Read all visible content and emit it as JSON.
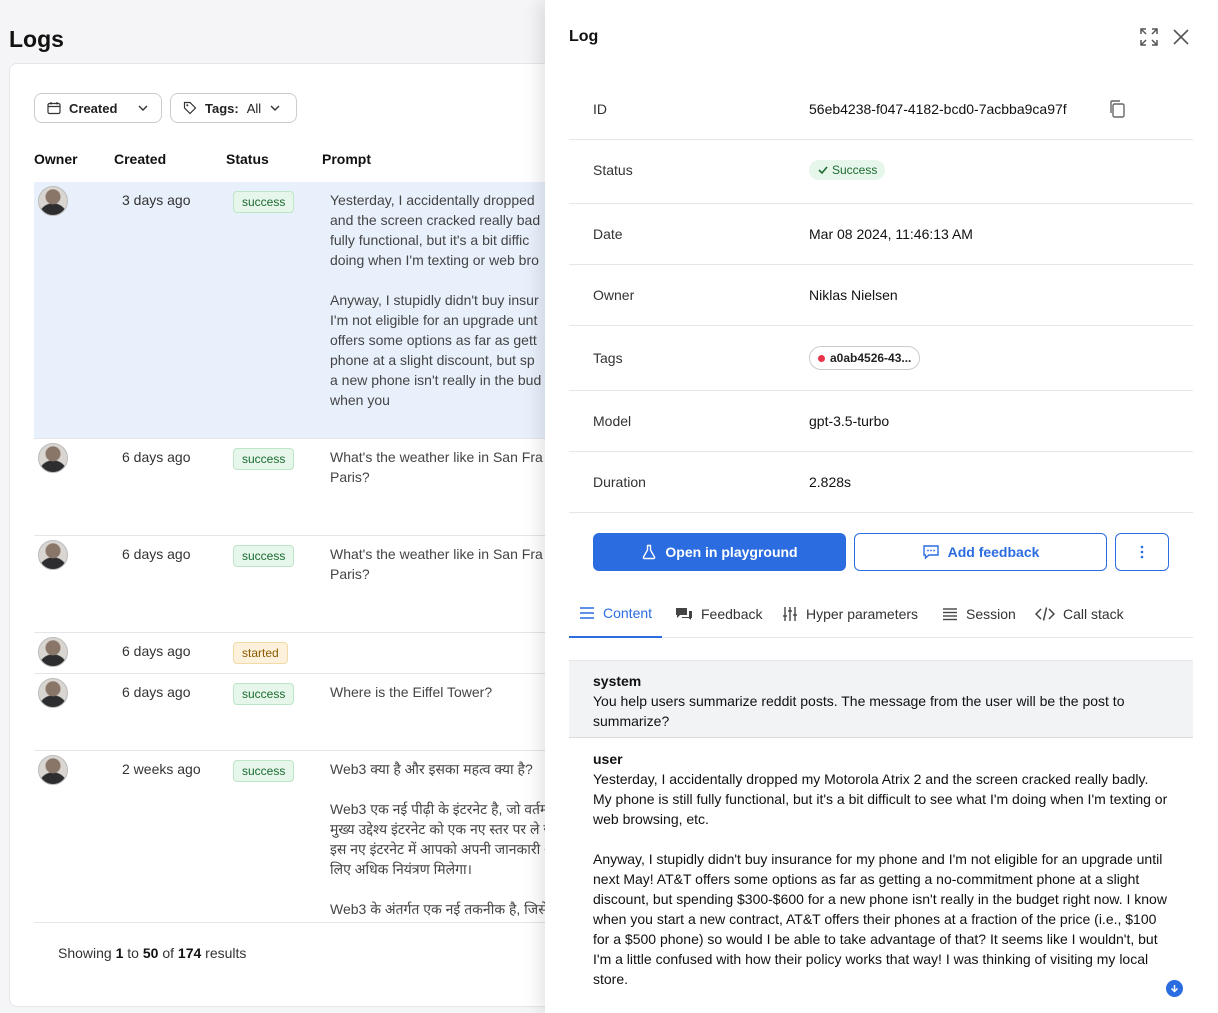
{
  "page": {
    "title": "Logs"
  },
  "filters": {
    "created_label": "Created",
    "tags_label": "Tags:",
    "tags_value": "All"
  },
  "table": {
    "headers": [
      "Owner",
      "Created",
      "Status",
      "Prompt"
    ],
    "rows": [
      {
        "created": "3 days ago",
        "status": "success",
        "prompt": "Yesterday, I accidentally dropped\nand the screen cracked really bad\nfully functional, but it's a bit diffic\ndoing when I'm texting or web bro\n\nAnyway, I stupidly didn't buy insur\nI'm not eligible for an upgrade unt\noffers some options as far as gett\nphone at a slight discount, but sp\na new phone isn't really in the bud\nwhen you"
      },
      {
        "created": "6 days ago",
        "status": "success",
        "prompt": "What's the weather like in San Fra\nParis?"
      },
      {
        "created": "6 days ago",
        "status": "success",
        "prompt": "What's the weather like in San Fra\nParis?"
      },
      {
        "created": "6 days ago",
        "status": "started",
        "prompt": ""
      },
      {
        "created": "6 days ago",
        "status": "success",
        "prompt": "Where is the Eiffel Tower?"
      },
      {
        "created": "2 weeks ago",
        "status": "success",
        "prompt": "Web3 क्या है और इसका महत्व क्या है?\n\nWeb3 एक नई पीढ़ी के इंटरनेट है, जो वर्तम\nमुख्य उद्देश्य इंटरनेट को एक नए स्तर पर ले ज\nइस नए इंटरनेट में आपको अपनी जानकारी अ\nलिए अधिक नियंत्रण मिलेगा।\n\nWeb3 के अंतर्गत एक नई तकनीक है, जिसे"
      }
    ]
  },
  "footer": {
    "showing": "Showing",
    "from": "1",
    "to_word": "to",
    "to": "50",
    "of_word": "of",
    "total": "174",
    "results": "results"
  },
  "panel": {
    "title": "Log",
    "details": {
      "id_label": "ID",
      "id_value": "56eb4238-f047-4182-bcd0-7acbba9ca97f",
      "status_label": "Status",
      "status_value": "Success",
      "date_label": "Date",
      "date_value": "Mar 08 2024, 11:46:13 AM",
      "owner_label": "Owner",
      "owner_value": "Niklas Nielsen",
      "tags_label": "Tags",
      "tag_value": "a0ab4526-43...",
      "model_label": "Model",
      "model_value": "gpt-3.5-turbo",
      "duration_label": "Duration",
      "duration_value": "2.828s"
    },
    "actions": {
      "playground": "Open in playground",
      "feedback": "Add feedback"
    },
    "tabs": {
      "content": "Content",
      "feedback": "Feedback",
      "hyper": "Hyper parameters",
      "session": "Session",
      "callstack": "Call stack"
    },
    "messages": {
      "system_role": "system",
      "system_text": "You help users summarize reddit posts. The message from the user will be the post to summarize?",
      "user_role": "user",
      "user_text": "Yesterday, I accidentally dropped my Motorola Atrix 2 and the screen cracked really badly. My phone is still fully functional, but it's a bit difficult to see what I'm doing when I'm texting or web browsing, etc.\n\nAnyway, I stupidly didn't buy insurance for my phone and I'm not eligible for an upgrade until next May! AT&T offers some options as far as getting a no-commitment phone at a slight discount, but spending $300-$600 for a new phone isn't really in the budget right now. I know when you start a new contract, AT&T offers their phones at a fraction of the price (i.e., $100 for a $500 phone) so would I be able to take advantage of that? It seems like I wouldn't, but I'm a little confused with how their policy works that way! I was thinking of visiting my local store."
    }
  },
  "colors": {
    "accent": "#2b6ce0",
    "success_bg": "#e6f6ea",
    "started_bg": "#fdf1dc",
    "selected_row": "#e8f0fc",
    "tag_dot": "#e8334a"
  }
}
